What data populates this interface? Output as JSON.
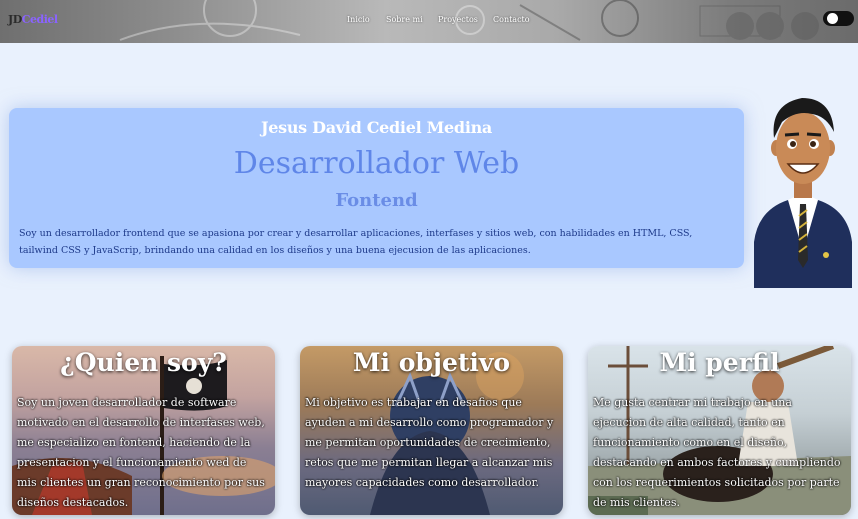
{
  "nav": {
    "brand_prefix": "JD",
    "brand_name": "Cediel",
    "links": [
      "Inicio",
      "Sobre mi",
      "Proyectos",
      "Contacto"
    ]
  },
  "hero": {
    "name": "Jesus David Cediel Medina",
    "role": "Desarrollador Web",
    "subrole": "Fontend",
    "description": "Soy un desarrollador frontend que se apasiona por crear y desarrollar aplicaciones, interfases y sitios web, con habilidades en HTML, CSS, tailwind CSS y JavaScrip, brindando una calidad en los diseños y una buena ejecusion de las aplicaciones."
  },
  "cards": [
    {
      "title": "¿Quien soy?",
      "text": "Soy un joven desarrollador de software motivado en el desarrollo de interfases web, me especializo en fontend, haciendo de la presentacion y el funcionamiento wed de mis clientes un gran reconocimiento por sus diseños destacados."
    },
    {
      "title": "Mi objetivo",
      "text": "Mi objetivo es trabajar en desafios que ayuden a mi desarrollo como programador y me permitan oportunidades de crecimiento, retos que me permitan llegar a alcanzar mis mayores capacidades como desarrollador."
    },
    {
      "title": "Mi perfil",
      "text": "Me gusta centrar mi trabajo en una ejecucion de alta calidad, tanto en funcionamiento como en el diseño, destacando en ambos factores y cumpliendo con los requerimientos solicitados por parte de mis clientes."
    }
  ],
  "colors": {
    "accent": "#8a63ff",
    "hero_bg": "#a9c8ff",
    "role_text": "#5f86e8",
    "page_bg": "#e9f1fd"
  }
}
